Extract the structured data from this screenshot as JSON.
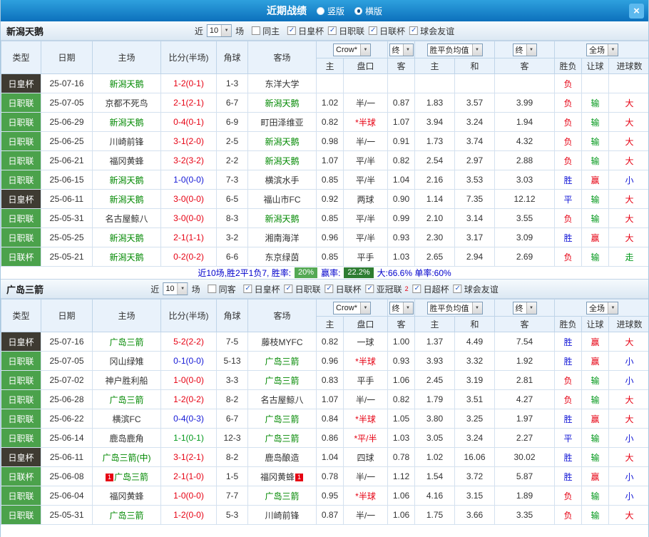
{
  "topbar": {
    "title": "近期战绩",
    "vertical_label": "竖版",
    "horizontal_label": "横版",
    "vertical_selected": false,
    "horizontal_selected": true
  },
  "icons": {
    "chevron_down": "▼",
    "check": "✓",
    "close": "×"
  },
  "labels": {
    "near": "近",
    "near_count": "10",
    "matches": "场"
  },
  "table_header": {
    "type": "类型",
    "date": "日期",
    "home": "主场",
    "score": "比分(半场)",
    "corner": "角球",
    "away": "客场",
    "sel_company": "Crow*",
    "sel_final": "终",
    "sel_avg": "胜平负均值",
    "sel_scope": "全场",
    "odds_home": "主",
    "handicap": "盘口",
    "odds_away": "客",
    "avg_home": "主",
    "avg_draw": "和",
    "avg_away": "客",
    "result": "胜负",
    "handicap_result": "让球",
    "goals": "进球数"
  },
  "value_colors": {
    "胜": "#1317d6",
    "平": "#1317d6",
    "负": "#e60012",
    "赢": "#e60012",
    "输": "#02981b",
    "走": "#02981b",
    "大": "#e60012",
    "小": "#1317d6"
  },
  "theme": {
    "topbar_blue": "#1287d3",
    "league_green": "#4ba24b",
    "cup_dark": "#3f3b32",
    "focal_team_green": "#008800",
    "header_bg": "#e9f2fb"
  },
  "sections": [
    {
      "team": "新潟天鹅",
      "same_venue": "同主",
      "leagues": [
        {
          "label": "日皇杯",
          "checked": true
        },
        {
          "label": "日职联",
          "checked": true
        },
        {
          "label": "日联杯",
          "checked": true
        },
        {
          "label": "球会友谊",
          "checked": true
        }
      ],
      "rows": [
        {
          "league": "日皇杯",
          "style": "cup",
          "date": "25-07-16",
          "home": "新潟天鹅",
          "home_focal": true,
          "home_badge": "",
          "score": "1-2(0-1)",
          "score_color": "red",
          "corners": "1-3",
          "away": "东洋大学",
          "away_focal": false,
          "away_badge": "",
          "odds": [
            "",
            "",
            "",
            "",
            "",
            ""
          ],
          "result": "负",
          "handicap_result": "",
          "goals": ""
        },
        {
          "league": "日职联",
          "style": "league",
          "date": "25-07-05",
          "home": "京都不死鸟",
          "home_focal": false,
          "home_badge": "",
          "score": "2-1(2-1)",
          "score_color": "red",
          "corners": "6-7",
          "away": "新潟天鹅",
          "away_focal": true,
          "away_badge": "",
          "odds": [
            "1.02",
            "半/一",
            "0.87",
            "1.83",
            "3.57",
            "3.99"
          ],
          "result": "负",
          "handicap_result": "输",
          "goals": "大"
        },
        {
          "league": "日职联",
          "style": "league",
          "date": "25-06-29",
          "home": "新潟天鹅",
          "home_focal": true,
          "home_badge": "",
          "score": "0-4(0-1)",
          "score_color": "red",
          "corners": "6-9",
          "away": "町田泽维亚",
          "away_focal": false,
          "away_badge": "",
          "odds": [
            "0.82",
            "*半球",
            "1.07",
            "3.94",
            "3.24",
            "1.94"
          ],
          "result": "负",
          "handicap_result": "输",
          "goals": "大"
        },
        {
          "league": "日职联",
          "style": "league",
          "date": "25-06-25",
          "home": "川崎前锋",
          "home_focal": false,
          "home_badge": "",
          "score": "3-1(2-0)",
          "score_color": "red",
          "corners": "2-5",
          "away": "新潟天鹅",
          "away_focal": true,
          "away_badge": "",
          "odds": [
            "0.98",
            "半/一",
            "0.91",
            "1.73",
            "3.74",
            "4.32"
          ],
          "result": "负",
          "handicap_result": "输",
          "goals": "大"
        },
        {
          "league": "日职联",
          "style": "league",
          "date": "25-06-21",
          "home": "福冈黄蜂",
          "home_focal": false,
          "home_badge": "",
          "score": "3-2(3-2)",
          "score_color": "red",
          "corners": "2-2",
          "away": "新潟天鹅",
          "away_focal": true,
          "away_badge": "",
          "odds": [
            "1.07",
            "平/半",
            "0.82",
            "2.54",
            "2.97",
            "2.88"
          ],
          "result": "负",
          "handicap_result": "输",
          "goals": "大"
        },
        {
          "league": "日职联",
          "style": "league",
          "date": "25-06-15",
          "home": "新潟天鹅",
          "home_focal": true,
          "home_badge": "",
          "score": "1-0(0-0)",
          "score_color": "blue",
          "corners": "7-3",
          "away": "横滨水手",
          "away_focal": false,
          "away_badge": "",
          "odds": [
            "0.85",
            "平/半",
            "1.04",
            "2.16",
            "3.53",
            "3.03"
          ],
          "result": "胜",
          "handicap_result": "赢",
          "goals": "小"
        },
        {
          "league": "日皇杯",
          "style": "cup",
          "date": "25-06-11",
          "home": "新潟天鹅",
          "home_focal": true,
          "home_badge": "",
          "score": "3-0(0-0)",
          "score_color": "red",
          "corners": "6-5",
          "away": "福山市FC",
          "away_focal": false,
          "away_badge": "",
          "odds": [
            "0.92",
            "两球",
            "0.90",
            "1.14",
            "7.35",
            "12.12"
          ],
          "result": "平",
          "handicap_result": "输",
          "goals": "大"
        },
        {
          "league": "日职联",
          "style": "league",
          "date": "25-05-31",
          "home": "名古屋鲸八",
          "home_focal": false,
          "home_badge": "",
          "score": "3-0(0-0)",
          "score_color": "red",
          "corners": "8-3",
          "away": "新潟天鹅",
          "away_focal": true,
          "away_badge": "",
          "odds": [
            "0.85",
            "平/半",
            "0.99",
            "2.10",
            "3.14",
            "3.55"
          ],
          "result": "负",
          "handicap_result": "输",
          "goals": "大"
        },
        {
          "league": "日职联",
          "style": "league",
          "date": "25-05-25",
          "home": "新潟天鹅",
          "home_focal": true,
          "home_badge": "",
          "score": "2-1(1-1)",
          "score_color": "red",
          "corners": "3-2",
          "away": "湘南海洋",
          "away_focal": false,
          "away_badge": "",
          "odds": [
            "0.96",
            "平/半",
            "0.93",
            "2.30",
            "3.17",
            "3.09"
          ],
          "result": "胜",
          "handicap_result": "赢",
          "goals": "大"
        },
        {
          "league": "日联杯",
          "style": "league",
          "date": "25-05-21",
          "home": "新潟天鹅",
          "home_focal": true,
          "home_badge": "",
          "score": "0-2(0-2)",
          "score_color": "red",
          "corners": "6-6",
          "away": "东京绿茵",
          "away_focal": false,
          "away_badge": "",
          "odds": [
            "0.85",
            "平手",
            "1.03",
            "2.65",
            "2.94",
            "2.69"
          ],
          "result": "负",
          "handicap_result": "输",
          "goals": "走"
        }
      ],
      "summary": {
        "prefix": "近10场,胜2平1负7, 胜率:",
        "win_rate": "20%",
        "profit_label": "赢率:",
        "profit_rate": "22.2%",
        "suffix": "大:66.6% 单率:60%"
      }
    },
    {
      "team": "广岛三箭",
      "same_venue": "同客",
      "leagues": [
        {
          "label": "日皇杯",
          "checked": true
        },
        {
          "label": "日职联",
          "checked": true
        },
        {
          "label": "日联杯",
          "checked": true
        },
        {
          "label": "亚冠联",
          "badge": "2",
          "checked": true
        },
        {
          "label": "日超杯",
          "checked": true
        },
        {
          "label": "球会友谊",
          "checked": true
        }
      ],
      "rows": [
        {
          "league": "日皇杯",
          "style": "cup",
          "date": "25-07-16",
          "home": "广岛三箭",
          "home_focal": true,
          "home_badge": "",
          "score": "5-2(2-2)",
          "score_color": "red",
          "corners": "7-5",
          "away": "藤枝MYFC",
          "away_focal": false,
          "away_badge": "",
          "odds": [
            "0.82",
            "一球",
            "1.00",
            "1.37",
            "4.49",
            "7.54"
          ],
          "result": "胜",
          "handicap_result": "赢",
          "goals": "大"
        },
        {
          "league": "日职联",
          "style": "league",
          "date": "25-07-05",
          "home": "冈山绿雉",
          "home_focal": false,
          "home_badge": "",
          "score": "0-1(0-0)",
          "score_color": "blue",
          "corners": "5-13",
          "away": "广岛三箭",
          "away_focal": true,
          "away_badge": "",
          "odds": [
            "0.96",
            "*半球",
            "0.93",
            "3.93",
            "3.32",
            "1.92"
          ],
          "result": "胜",
          "handicap_result": "赢",
          "goals": "小"
        },
        {
          "league": "日职联",
          "style": "league",
          "date": "25-07-02",
          "home": "神户胜利船",
          "home_focal": false,
          "home_badge": "",
          "score": "1-0(0-0)",
          "score_color": "red",
          "corners": "3-3",
          "away": "广岛三箭",
          "away_focal": true,
          "away_badge": "",
          "odds": [
            "0.83",
            "平手",
            "1.06",
            "2.45",
            "3.19",
            "2.81"
          ],
          "result": "负",
          "handicap_result": "输",
          "goals": "小"
        },
        {
          "league": "日职联",
          "style": "league",
          "date": "25-06-28",
          "home": "广岛三箭",
          "home_focal": true,
          "home_badge": "",
          "score": "1-2(0-2)",
          "score_color": "red",
          "corners": "8-2",
          "away": "名古屋鲸八",
          "away_focal": false,
          "away_badge": "",
          "odds": [
            "1.07",
            "半/一",
            "0.82",
            "1.79",
            "3.51",
            "4.27"
          ],
          "result": "负",
          "handicap_result": "输",
          "goals": "大"
        },
        {
          "league": "日职联",
          "style": "league",
          "date": "25-06-22",
          "home": "横滨FC",
          "home_focal": false,
          "home_badge": "",
          "score": "0-4(0-3)",
          "score_color": "blue",
          "corners": "6-7",
          "away": "广岛三箭",
          "away_focal": true,
          "away_badge": "",
          "odds": [
            "0.84",
            "*半球",
            "1.05",
            "3.80",
            "3.25",
            "1.97"
          ],
          "result": "胜",
          "handicap_result": "赢",
          "goals": "大"
        },
        {
          "league": "日职联",
          "style": "league",
          "date": "25-06-14",
          "home": "鹿岛鹿角",
          "home_focal": false,
          "home_badge": "",
          "score": "1-1(0-1)",
          "score_color": "green",
          "corners": "12-3",
          "away": "广岛三箭",
          "away_focal": true,
          "away_badge": "",
          "odds": [
            "0.86",
            "*平/半",
            "1.03",
            "3.05",
            "3.24",
            "2.27"
          ],
          "result": "平",
          "handicap_result": "输",
          "goals": "小"
        },
        {
          "league": "日皇杯",
          "style": "cup",
          "date": "25-06-11",
          "home": "广岛三箭(中)",
          "home_focal": true,
          "home_badge": "",
          "score": "3-1(2-1)",
          "score_color": "red",
          "corners": "8-2",
          "away": "鹿岛酿造",
          "away_focal": false,
          "away_badge": "",
          "odds": [
            "1.04",
            "四球",
            "0.78",
            "1.02",
            "16.06",
            "30.02"
          ],
          "result": "胜",
          "handicap_result": "输",
          "goals": "大"
        },
        {
          "league": "日联杯",
          "style": "league",
          "date": "25-06-08",
          "home": "广岛三箭",
          "home_focal": true,
          "home_badge": "1",
          "score": "2-1(1-0)",
          "score_color": "red",
          "corners": "1-5",
          "away": "福冈黄蜂",
          "away_focal": false,
          "away_badge": "1",
          "odds": [
            "0.78",
            "半/一",
            "1.12",
            "1.54",
            "3.72",
            "5.87"
          ],
          "result": "胜",
          "handicap_result": "赢",
          "goals": "小"
        },
        {
          "league": "日职联",
          "style": "league",
          "date": "25-06-04",
          "home": "福冈黄蜂",
          "home_focal": false,
          "home_badge": "",
          "score": "1-0(0-0)",
          "score_color": "red",
          "corners": "7-7",
          "away": "广岛三箭",
          "away_focal": true,
          "away_badge": "",
          "odds": [
            "0.95",
            "*半球",
            "1.06",
            "4.16",
            "3.15",
            "1.89"
          ],
          "result": "负",
          "handicap_result": "输",
          "goals": "小"
        },
        {
          "league": "日职联",
          "style": "league",
          "date": "25-05-31",
          "home": "广岛三箭",
          "home_focal": true,
          "home_badge": "",
          "score": "1-2(0-0)",
          "score_color": "red",
          "corners": "5-3",
          "away": "川崎前锋",
          "away_focal": false,
          "away_badge": "",
          "odds": [
            "0.87",
            "半/一",
            "1.06",
            "1.75",
            "3.66",
            "3.35"
          ],
          "result": "负",
          "handicap_result": "输",
          "goals": "大"
        }
      ]
    }
  ]
}
